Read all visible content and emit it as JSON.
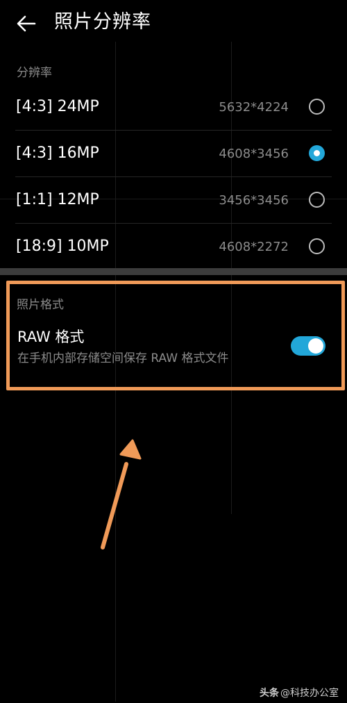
{
  "header": {
    "title": "照片分辨率",
    "back_icon": "arrow-left-icon"
  },
  "resolution": {
    "section_label": "分辨率",
    "options": [
      {
        "name": "[4:3] 24MP",
        "dims": "5632*4224",
        "selected": false
      },
      {
        "name": "[4:3] 16MP",
        "dims": "4608*3456",
        "selected": true
      },
      {
        "name": "[1:1] 12MP",
        "dims": "3456*3456",
        "selected": false
      },
      {
        "name": "[18:9] 10MP",
        "dims": "4608*2272",
        "selected": false
      }
    ]
  },
  "format": {
    "section_label": "照片格式",
    "raw": {
      "title": "RAW 格式",
      "description": "在手机内部存储空间保存 RAW 格式文件",
      "enabled": true
    }
  },
  "annotation": {
    "highlight_color": "#f09a58"
  },
  "colors": {
    "accent": "#22a7d9",
    "background": "#000000"
  },
  "watermark": {
    "brand": "头条",
    "handle": "@科技办公室"
  }
}
